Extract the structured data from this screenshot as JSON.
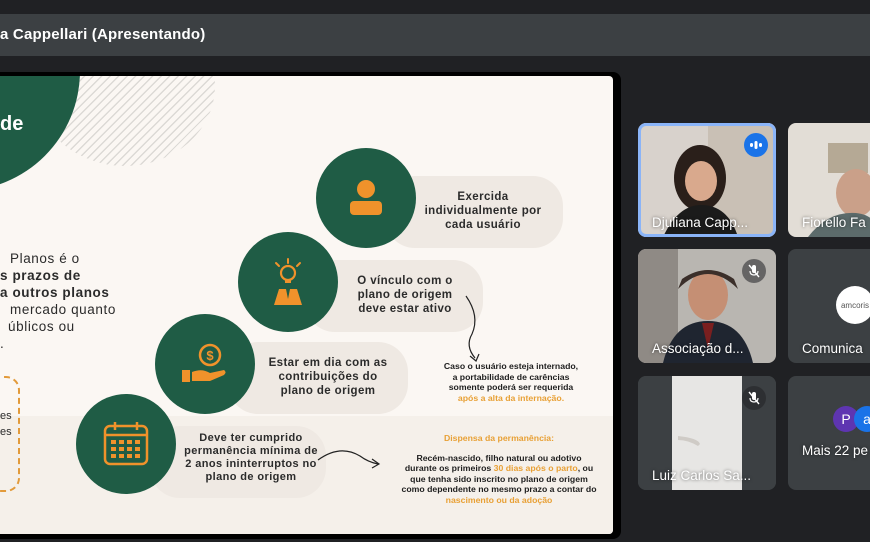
{
  "presenter": {
    "title": "a Cappellari (Apresentando)"
  },
  "slide": {
    "corner_text": "de",
    "left_lines": [
      "Planos é o",
      "s prazos de",
      "a outros planos",
      "mercado quanto",
      "úblicos ou",
      "."
    ],
    "box_lines": [
      "es",
      "es"
    ],
    "steps": [
      {
        "lines": [
          "Exercida",
          "individualmente por",
          "cada usuário"
        ],
        "icon": "person-icon"
      },
      {
        "lines": [
          "O vínculo com o",
          "plano de origem",
          "deve estar ativo"
        ],
        "icon": "idea-person-icon"
      },
      {
        "lines": [
          "Estar em dia com as",
          "contribuições do",
          "plano de origem"
        ],
        "icon": "money-hand-icon"
      },
      {
        "lines": [
          "Deve ter cumprido",
          "permanência mínima de",
          "2 anos ininterruptos no",
          "plano de origem"
        ],
        "icon": "calendar-icon"
      }
    ],
    "note1": {
      "lines": [
        "Caso o usuário esteja internado,",
        "a portabilidade de carências",
        "somente poderá ser requerida"
      ],
      "highlight": "após a alta da internação."
    },
    "note2": {
      "title": "Dispensa da permanência:",
      "line1": "Recém-nascido, filho natural ou adotivo",
      "line2_pre": "durante os primeiros ",
      "line2_hl": "30 dias após o parto",
      "line2_post": ", ou",
      "line3": "que tenha sido inscrito no plano de origem",
      "line4": "como dependente no mesmo prazo a contar do",
      "line5_hl": "nascimento ou da adoção"
    }
  },
  "participants": [
    {
      "name": "Djuliana Capp...",
      "status": "speaking"
    },
    {
      "name": "Fiorello Fa",
      "status": "none"
    },
    {
      "name": "Associação d...",
      "status": "muted"
    },
    {
      "name": "Comunica",
      "status": "none",
      "logo_text": "amcoris"
    },
    {
      "name": "Luiz Carlos Sa...",
      "status": "muted"
    },
    {
      "name": "Mais 22 pe",
      "status": "none",
      "avatar_letters": [
        "P",
        "a"
      ]
    }
  ],
  "colors": {
    "green": "#1f5c45",
    "orange": "#e8a035",
    "accent_blue": "#8ab4f8"
  }
}
